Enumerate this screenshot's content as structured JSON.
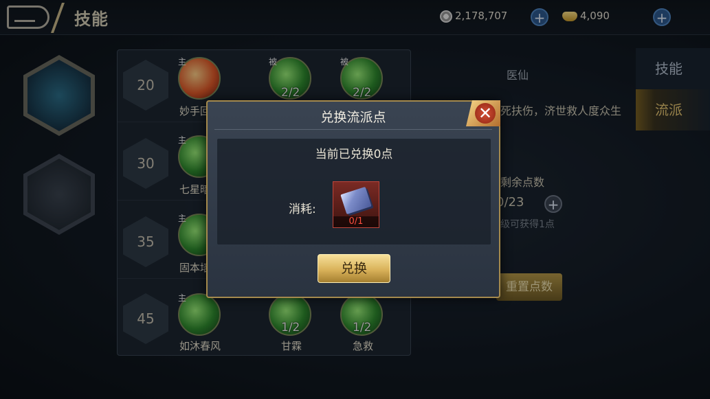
{
  "header": {
    "title": "技能",
    "silver_amount": "2,178,707",
    "gold_amount": "4,090",
    "add_label": "+"
  },
  "skill_rows": [
    {
      "level": "20",
      "skills": [
        {
          "tag": "主",
          "count": "",
          "name": "妙手回"
        },
        {
          "tag": "被",
          "count": "2/2",
          "name": ""
        },
        {
          "tag": "被",
          "count": "2/2",
          "name": ""
        }
      ]
    },
    {
      "level": "30",
      "skills": [
        {
          "tag": "主",
          "count": "",
          "name": "七星暗"
        }
      ]
    },
    {
      "level": "35",
      "skills": [
        {
          "tag": "主",
          "count": "",
          "name": "固本培"
        }
      ]
    },
    {
      "level": "45",
      "skills": [
        {
          "tag": "主",
          "count": "",
          "name": "如沐春风"
        },
        {
          "tag": "",
          "count": "1/2",
          "name": "甘霖"
        },
        {
          "tag": "",
          "count": "1/2",
          "name": "急救"
        }
      ]
    }
  ],
  "right_panel": {
    "tabs": [
      "技能",
      "流派"
    ],
    "school_name": "医仙",
    "school_desc": "死扶伤，济世救人度众生",
    "remaining_label": "剩余点数",
    "remaining_value": "0/23",
    "level_hint": "级可获得1点",
    "reset_label": "重置点数"
  },
  "dialog": {
    "title": "兑换流派点",
    "status": "当前已兑换0点",
    "cost_label": "消耗:",
    "item_count": "0/1",
    "confirm_label": "兑换",
    "close_label": "✕"
  }
}
